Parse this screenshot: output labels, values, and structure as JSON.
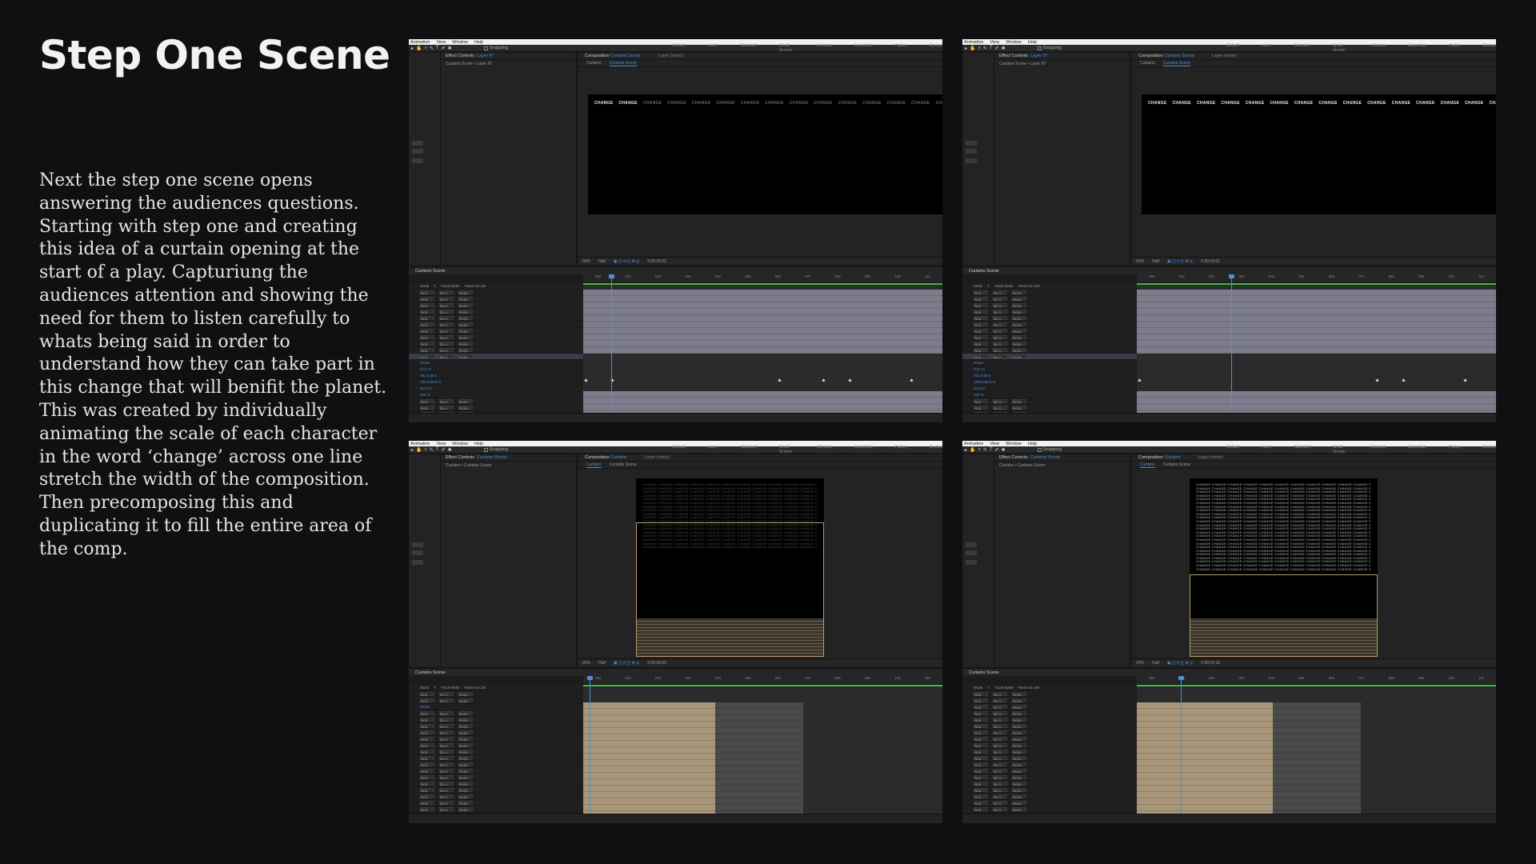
{
  "slide": {
    "title": "Step One Scene",
    "body": "Next the step one scene opens answering the audiences questions. Starting with step one and creating this idea of a curtain opening at the start of a play. Capturiung the audiences attention and showing the need for them to listen carefully to whats being said in order to understand how they can take part in this change that will benifit the planet. This was created by individually animating the scale of each character in the word ‘change’ across one line stretch the width of the composition. Then precomposing this and duplicating it to fill the entire area of the comp."
  },
  "app": {
    "menus": [
      "Animation",
      "View",
      "Window",
      "Help"
    ],
    "snapping_label": "Snapping",
    "workspaces": [
      "Default",
      "Learn",
      "Standard",
      "Small Screen",
      "Libraries",
      "Essentials",
      "Harley",
      "Review"
    ],
    "effect_controls_label": "Effect Controls",
    "composition_label": "Composition",
    "layer_label": "Layer (none)",
    "timeline_tab": "Curtains Scene",
    "quality": "Half",
    "columns": [
      "Mode",
      "T",
      "Track Matte",
      "Parent & Link"
    ],
    "mode_value": "Norr",
    "matte_value": "No A",
    "parent_value": "None",
    "ruler_ticks": [
      "00s",
      "01s",
      "02s",
      "03s",
      "04s",
      "05s",
      "06s",
      "07s",
      "08s",
      "09s",
      "10s",
      "11s"
    ]
  },
  "screens": [
    {
      "fx_target": "Layer 97",
      "fx_path": "Curtains Scene • Layer 97",
      "comp_name": "Curtains Scene",
      "subtabs": [
        "Curtains",
        "Curtains Scene"
      ],
      "zoom": "50%",
      "timecode": "0:00:00:22",
      "props": [
        "Reset",
        "0.0,7.0",
        "781.0,90.0",
        "781.0,90.0 %",
        "0x+0.0°",
        "100 %"
      ]
    },
    {
      "fx_target": "Layer 97",
      "fx_path": "Curtains Scene • Layer 97",
      "comp_name": "Curtains Scene",
      "subtabs": [
        "Curtains",
        "Curtains Scene"
      ],
      "zoom": "50%",
      "timecode": "0:00:03:01",
      "props": [
        "Reset",
        "0.0,7.0",
        "781.0,90.0",
        "1000,100.0 %",
        "0x+0.0°",
        "100 %"
      ]
    },
    {
      "fx_target": "Curtains Scene",
      "fx_path": "Curtains • Curtains Scene",
      "comp_name": "Curtains",
      "subtabs": [
        "Curtains",
        "Curtains Scene"
      ],
      "zoom": "25%",
      "timecode": "0:00:00:05",
      "props": [
        "Reset"
      ]
    },
    {
      "fx_target": "Curtains Scene",
      "fx_path": "Curtains • Curtains Scene",
      "comp_name": "Curtains",
      "subtabs": [
        "Curtains",
        "Curtains Scene"
      ],
      "zoom": "25%",
      "timecode": "0:00:01:10",
      "props": []
    }
  ],
  "viewer_text": {
    "word": "CHANGE"
  },
  "colors": {
    "background": "#101012",
    "accent_blue": "#4a8fe0",
    "layer_purple": "#7c7c8c",
    "layer_tan": "#a8967a",
    "work_area_green": "#3fbf3f"
  }
}
